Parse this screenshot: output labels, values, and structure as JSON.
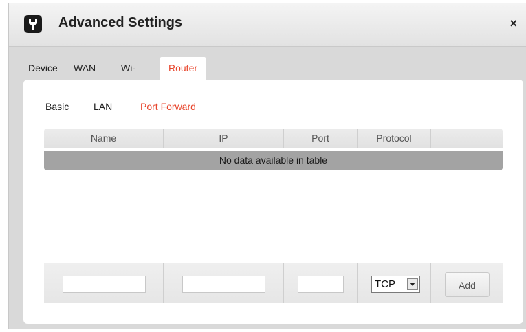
{
  "dialog": {
    "title": "Advanced Settings",
    "close_label": "×"
  },
  "tabs": [
    {
      "label": "Device"
    },
    {
      "label": "WAN"
    },
    {
      "label": "Wi-Fi"
    },
    {
      "label": "Router",
      "active": true
    }
  ],
  "subtabs": [
    {
      "label": "Basic"
    },
    {
      "label": "LAN"
    },
    {
      "label": "Port Forward",
      "active": true
    }
  ],
  "table": {
    "columns": [
      "Name",
      "IP",
      "Port",
      "Protocol"
    ],
    "empty_message": "No data available in table"
  },
  "form": {
    "name_value": "",
    "ip_value": "",
    "port_value": "",
    "protocol_selected": "TCP",
    "add_label": "Add"
  },
  "colors": {
    "accent": "#e8452c",
    "empty_row": "#a3a3a3"
  }
}
